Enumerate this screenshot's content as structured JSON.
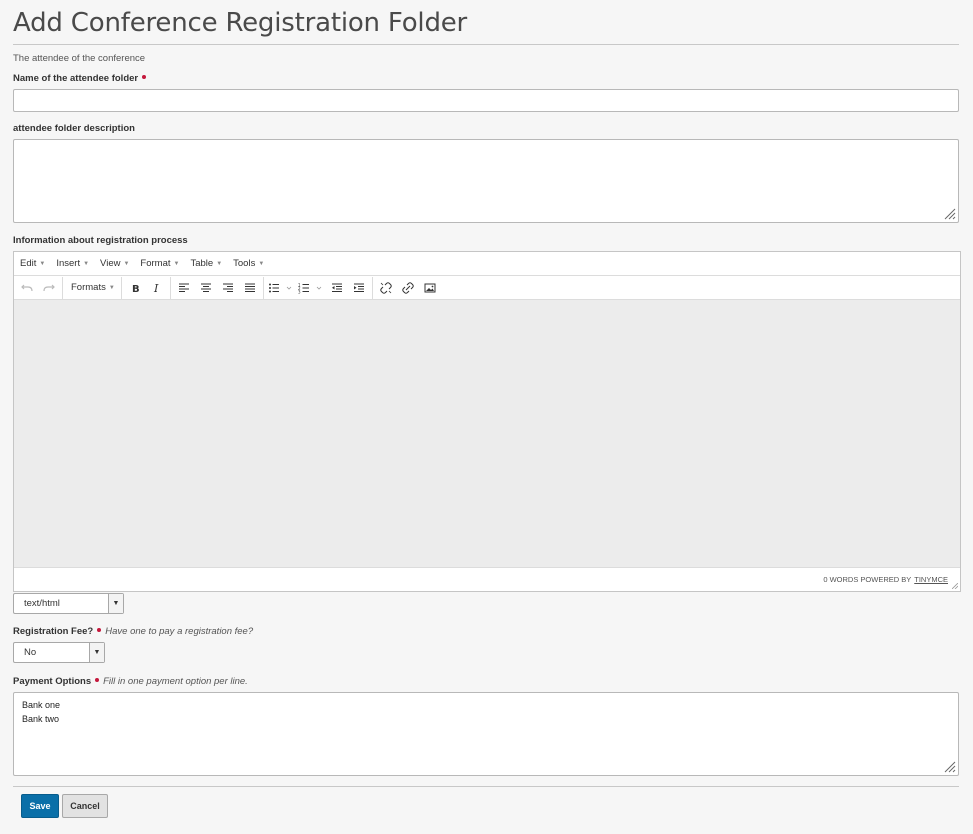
{
  "page": {
    "title": "Add Conference Registration Folder",
    "description": "The attendee of the conference"
  },
  "form": {
    "name_label": "Name of the attendee folder",
    "name_value": "",
    "folder_desc_label": "attendee folder description",
    "folder_desc_value": "",
    "info_label": "Information about registration process",
    "mimetype_value": "text/html",
    "fee_label": "Registration Fee?",
    "fee_hint": "Have one to pay a registration fee?",
    "fee_value": "No",
    "payment_label": "Payment Options",
    "payment_hint": "Fill in one payment option per line.",
    "payment_value": "Bank one\nBank two"
  },
  "editor": {
    "menu": [
      "Edit",
      "Insert",
      "View",
      "Format",
      "Table",
      "Tools"
    ],
    "formats_label": "Formats",
    "status_words": "0 WORDS POWERED BY",
    "status_link": "TINYMCE",
    "toolbar_icons": [
      "undo-icon",
      "redo-icon",
      "bold-icon",
      "italic-icon",
      "align-left-icon",
      "align-center-icon",
      "align-right-icon",
      "align-justify-icon",
      "bullet-list-icon",
      "numbered-list-icon",
      "outdent-icon",
      "indent-icon",
      "unlink-icon",
      "link-icon",
      "image-icon"
    ]
  },
  "actions": {
    "save": "Save",
    "cancel": "Cancel"
  },
  "colors": {
    "required_dot": "#c4183c",
    "primary_button": "#0a6fa8",
    "background": "#f6f6f6"
  }
}
